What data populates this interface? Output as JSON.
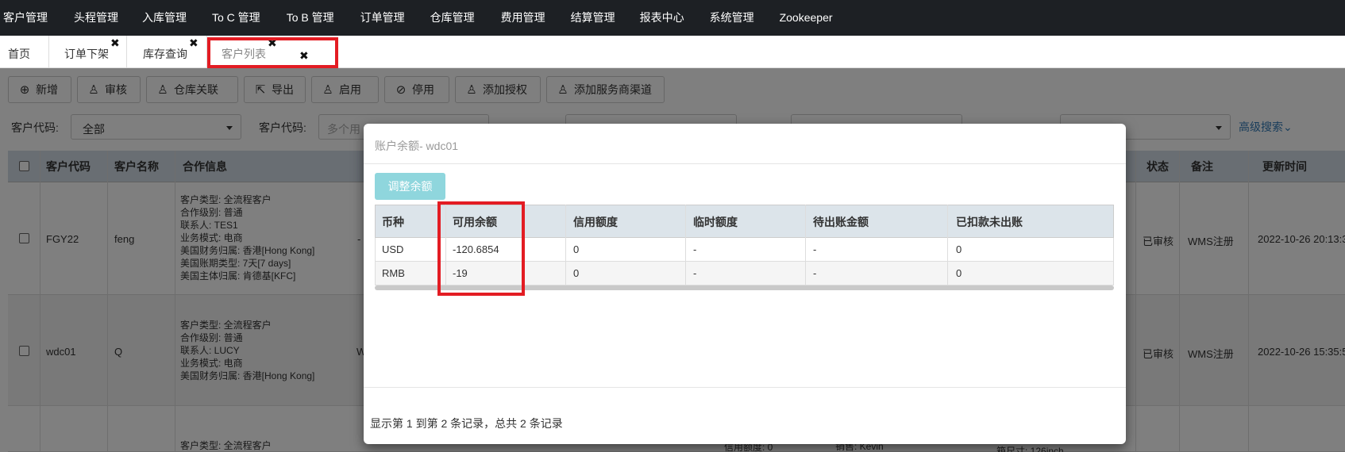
{
  "topnav": {
    "items": [
      "客户管理",
      "头程管理",
      "入库管理",
      "To C 管理",
      "To B 管理",
      "订单管理",
      "仓库管理",
      "费用管理",
      "结算管理",
      "报表中心",
      "系统管理",
      "Zookeeper"
    ]
  },
  "tabs": {
    "items": [
      {
        "label": "首页"
      },
      {
        "label": "订单下架",
        "close": "✖"
      },
      {
        "label": "库存查询",
        "close": "✖"
      },
      {
        "label": "客户列表",
        "close": "✖"
      }
    ],
    "extra_close": "✖"
  },
  "toolbar": {
    "buttons": [
      {
        "label": "新增",
        "icon": "⊕"
      },
      {
        "label": "审核",
        "icon": "♙"
      },
      {
        "label": "仓库关联",
        "icon": "♙"
      },
      {
        "label": "导出",
        "icon": "⇱"
      },
      {
        "label": "启用",
        "icon": "♙"
      },
      {
        "label": "停用",
        "icon": "⊘"
      },
      {
        "label": "添加授权",
        "icon": "♙"
      },
      {
        "label": "添加服务商渠道",
        "icon": "♙"
      }
    ]
  },
  "filters": {
    "code_label": "客户代码:",
    "code_select": "全部",
    "code2_label": "客户代码:",
    "code2_placeholder": "多个用",
    "advanced": "高级搜索"
  },
  "table": {
    "headers": [
      "客户代码",
      "客户名称",
      "合作信息",
      "状态",
      "备注",
      "更新时间"
    ],
    "rows": [
      {
        "code": "FGY22",
        "name": "feng",
        "coop": [
          "客户类型: 全流程客户",
          "合作级别: 普通",
          "联系人: TES1",
          "业务模式: 电商",
          "美国财务归属: 香港[Hong Kong]",
          "美国账期类型: 7天[7 days]",
          "美国主体归属: 肯德基[KFC]"
        ],
        "partial": "-",
        "status": "已审核",
        "remark": "WMS注册",
        "updated": "2022-10-26 20:13:3"
      },
      {
        "code": "wdc01",
        "name": "Q",
        "coop": [
          "客户类型: 全流程客户",
          "合作级别: 普通",
          "联系人: LUCY",
          "业务模式: 电商",
          "美国财务归属: 香港[Hong Kong]"
        ],
        "partial": "W",
        "status": "已审核",
        "remark": "WMS注册",
        "updated": "2022-10-26 15:35:5"
      },
      {
        "code": "",
        "name": "",
        "coop": [
          "客户类型: 全流程客户"
        ],
        "partial": "",
        "extra1": "信用额度: 0",
        "extra2": "销售: Kevin",
        "extra3": "箱尺寸: 126inch",
        "status": "",
        "remark": "",
        "updated": ""
      }
    ]
  },
  "modal": {
    "title": "账户余额- wdc01",
    "adjust_button": "调整余额",
    "columns": [
      "币种",
      "可用余额",
      "信用额度",
      "临时额度",
      "待出账金额",
      "已扣款未出账"
    ],
    "rows": [
      [
        "USD",
        "-120.6854",
        "0",
        "-",
        "-",
        "0"
      ],
      [
        "RMB",
        "-19",
        "0",
        "-",
        "-",
        "0"
      ]
    ],
    "footer": "显示第 1 到第 2 条记录，总共 2 条记录"
  }
}
